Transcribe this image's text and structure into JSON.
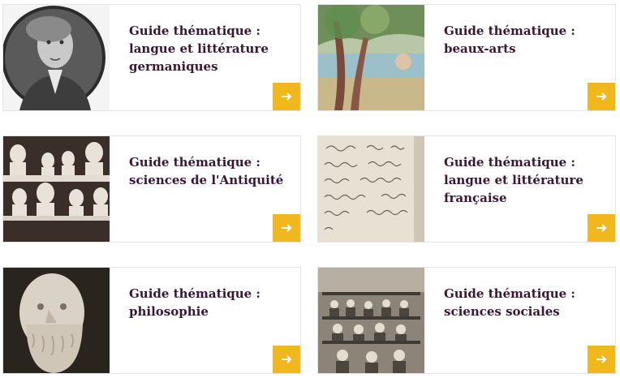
{
  "cards": [
    {
      "line1": "Guide thématique :",
      "line2": "langue et littérature",
      "line3": "germaniques",
      "image": "portrait-engraving",
      "arrow_icon": "arrow-right-icon"
    },
    {
      "line1": "Guide thématique :",
      "line2": "beaux-arts",
      "line3": "",
      "image": "pointillist-landscape",
      "arrow_icon": "arrow-right-icon"
    },
    {
      "line1": "Guide thématique :",
      "line2": "sciences de l'Antiquité",
      "line3": "",
      "image": "antique-busts",
      "arrow_icon": "arrow-right-icon"
    },
    {
      "line1": "Guide thématique :",
      "line2": "langue et littérature",
      "line3": "française",
      "image": "handwritten-manuscript",
      "arrow_icon": "arrow-right-icon"
    },
    {
      "line1": "Guide thématique :",
      "line2": "philosophie",
      "line3": "",
      "image": "socrates-bust",
      "arrow_icon": "arrow-right-icon"
    },
    {
      "line1": "Guide thématique :",
      "line2": "sciences sociales",
      "line3": "",
      "image": "factory-workers-photo",
      "arrow_icon": "arrow-right-icon"
    }
  ],
  "colors": {
    "title": "#3a1735",
    "accent": "#f1b81d",
    "border": "#e4e4e4"
  }
}
